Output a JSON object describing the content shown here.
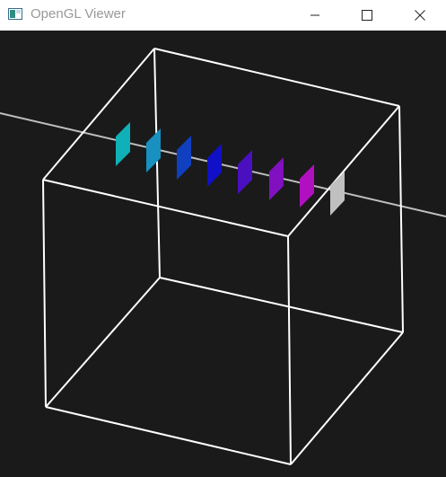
{
  "window": {
    "title": "OpenGL Viewer"
  },
  "controls": {
    "minimize": "minimize-icon",
    "maximize": "maximize-icon",
    "close": "close-icon"
  },
  "scene": {
    "background": "#1a1a1a",
    "cube_color": "#ffffff",
    "axis_line_color": "#bfbfbf",
    "slice_colors": [
      "#10b0b8",
      "#1890c0",
      "#1040c0",
      "#1010c8",
      "#4a10c0",
      "#8010c0",
      "#b010c0",
      "#c0c0c0"
    ]
  }
}
